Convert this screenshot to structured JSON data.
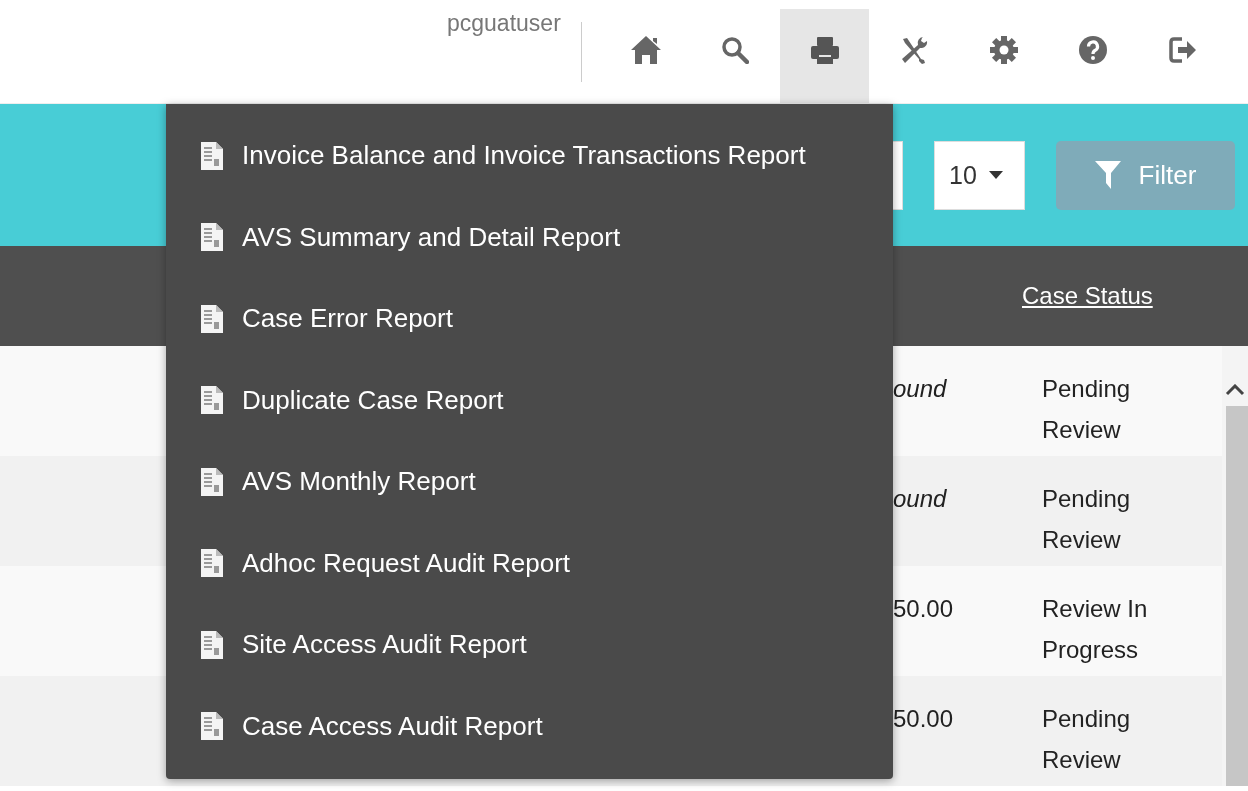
{
  "header": {
    "username": "pcguatuser",
    "nav": [
      {
        "kind": "home",
        "selected": false
      },
      {
        "kind": "search",
        "selected": false
      },
      {
        "kind": "print",
        "selected": true
      },
      {
        "kind": "tools",
        "selected": false
      },
      {
        "kind": "settings",
        "selected": false
      },
      {
        "kind": "help",
        "selected": false
      },
      {
        "kind": "logout",
        "selected": false
      }
    ]
  },
  "toolbar": {
    "page_size": "10",
    "filter_button": "Filter"
  },
  "table": {
    "columns": [
      "Case Status"
    ],
    "rows": [
      {
        "column_1": "ound",
        "case_status": "Pending Review"
      },
      {
        "column_1": "ound",
        "case_status": "Pending Review"
      },
      {
        "column_1": "50.00",
        "case_status": "Review In Progress"
      },
      {
        "column_1": "50.00",
        "case_status": "Pending Review"
      }
    ]
  },
  "reports_menu": {
    "items": [
      {
        "label": "Invoice Balance and Invoice Transactions Report"
      },
      {
        "label": "AVS Summary and Detail Report"
      },
      {
        "label": "Case Error Report"
      },
      {
        "label": "Duplicate Case Report"
      },
      {
        "label": "AVS Monthly Report"
      },
      {
        "label": "Adhoc Request Audit Report"
      },
      {
        "label": "Site Access Audit Report"
      },
      {
        "label": "Case Access Audit Report"
      }
    ]
  }
}
